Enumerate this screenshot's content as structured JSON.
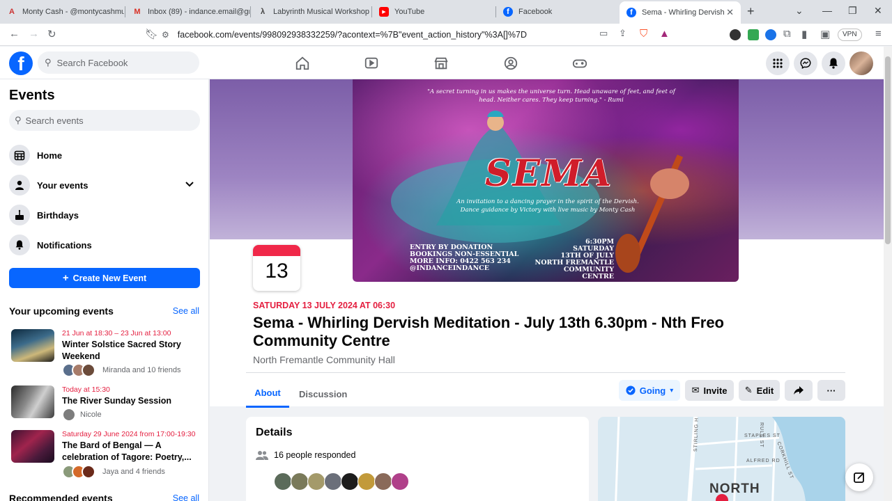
{
  "browser": {
    "tabs": [
      {
        "title": "Monty Cash - @montycashmus",
        "favicon": "A"
      },
      {
        "title": "Inbox (89) - indance.email@gm",
        "favicon": "M"
      },
      {
        "title": "Labyrinth Musical Workshop - C",
        "favicon": "λ"
      },
      {
        "title": "YouTube",
        "favicon": "▶"
      },
      {
        "title": "Facebook",
        "favicon": "f"
      },
      {
        "title": "Sema - Whirling Dervish M",
        "favicon": "f"
      }
    ],
    "url": "facebook.com/events/998092938332259/?acontext=%7B\"event_action_history\"%3A[]%7D",
    "vpn_label": "VPN",
    "brave_badge": "1"
  },
  "fb": {
    "search_placeholder": "Search Facebook",
    "accent": "#0866ff"
  },
  "sidebar": {
    "title": "Events",
    "search_placeholder": "Search events",
    "items": [
      {
        "label": "Home",
        "icon": "calendar-grid-icon"
      },
      {
        "label": "Your events",
        "icon": "person-icon"
      },
      {
        "label": "Birthdays",
        "icon": "cake-icon"
      },
      {
        "label": "Notifications",
        "icon": "bell-icon"
      }
    ],
    "create_label": "Create New Event",
    "upcoming_title": "Your upcoming events",
    "see_all": "See all",
    "upcoming": [
      {
        "date": "21 Jun at 18:30 – 23 Jun at 13:00",
        "title": "Winter Solstice Sacred Story Weekend",
        "friends": "Miranda and 10 friends"
      },
      {
        "date": "Today at 15:30",
        "title": "The River Sunday Session",
        "friends": "Nicole"
      },
      {
        "date": "Saturday 29 June 2024 from 17:00-19:30",
        "title": "The Bard of Bengal — A celebration of Tagore: Poetry,...",
        "friends": "Jaya and 4 friends"
      }
    ],
    "recommended_title": "Recommended events",
    "recommended_see_all": "See all"
  },
  "event": {
    "poster": {
      "quote": "\"A secret turning in us makes the universe turn. Head unaware of feet, and feet of head. Neither cares. They keep turning.\" - Rumi",
      "title": "SEMA",
      "subtitle": "An invitation to a dancing prayer in the spirit of the Dervish. Dance guidance by Victory with live music by Monty Cash",
      "info_left": [
        "ENTRY BY DONATION",
        "BOOKINGS NON-ESSENTIAL",
        "MORE INFO: 0422 563 234",
        "@INDANCEINDANCE"
      ],
      "info_right": [
        "6:30PM",
        "SATURDAY",
        "13TH OF JULY",
        "NORTH FREMANTLE",
        "COMMUNITY CENTRE"
      ]
    },
    "day": "13",
    "when": "SATURDAY 13 JULY 2024 AT 06:30",
    "name": "Sema - Whirling Dervish Meditation - July 13th 6.30pm - Nth Freo Community Centre",
    "location": "North Fremantle Community Hall",
    "tabs": [
      "About",
      "Discussion"
    ],
    "actions": {
      "going": "Going",
      "invite": "Invite",
      "edit": "Edit",
      "more": "···"
    },
    "details_title": "Details",
    "responded": "16 people responded",
    "map": {
      "streets": [
        "STIRLING H",
        "STAPLES ST",
        "ALFRED RD",
        "CORKHILL ST",
        "RULE ST"
      ],
      "area": "NORTH"
    }
  }
}
